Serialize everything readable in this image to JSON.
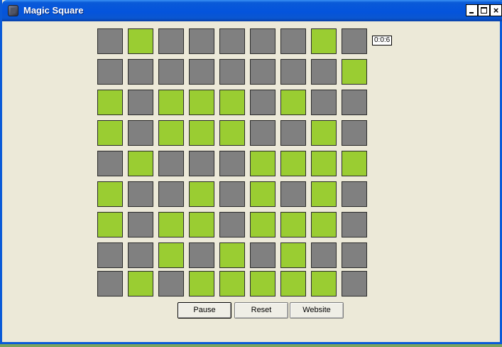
{
  "window": {
    "title": "Magic Square",
    "icon": "app-icon",
    "controls": {
      "minimize": "minimize-icon",
      "maximize": "maximize-icon",
      "close": "×"
    }
  },
  "timer": "0:0:6",
  "colors": {
    "on": "#9acd32",
    "off": "#808080",
    "background": "#ece9d8",
    "titlebar": "#0454dc"
  },
  "board": {
    "size": 9,
    "rows": [
      [
        0,
        1,
        0,
        0,
        0,
        0,
        0,
        1,
        0
      ],
      [
        0,
        0,
        0,
        0,
        0,
        0,
        0,
        0,
        1
      ],
      [
        1,
        0,
        1,
        1,
        1,
        0,
        1,
        0,
        0
      ],
      [
        1,
        0,
        1,
        1,
        1,
        0,
        0,
        1,
        0
      ],
      [
        0,
        1,
        0,
        0,
        0,
        1,
        1,
        1,
        1
      ],
      [
        1,
        0,
        0,
        1,
        0,
        1,
        0,
        1,
        0
      ],
      [
        1,
        0,
        1,
        1,
        0,
        1,
        1,
        1,
        0
      ],
      [
        0,
        0,
        1,
        0,
        1,
        0,
        1,
        0,
        0
      ],
      [
        0,
        1,
        0,
        1,
        1,
        1,
        1,
        1,
        0
      ]
    ]
  },
  "buttons": {
    "pause": "Pause",
    "reset": "Reset",
    "website": "Website"
  }
}
